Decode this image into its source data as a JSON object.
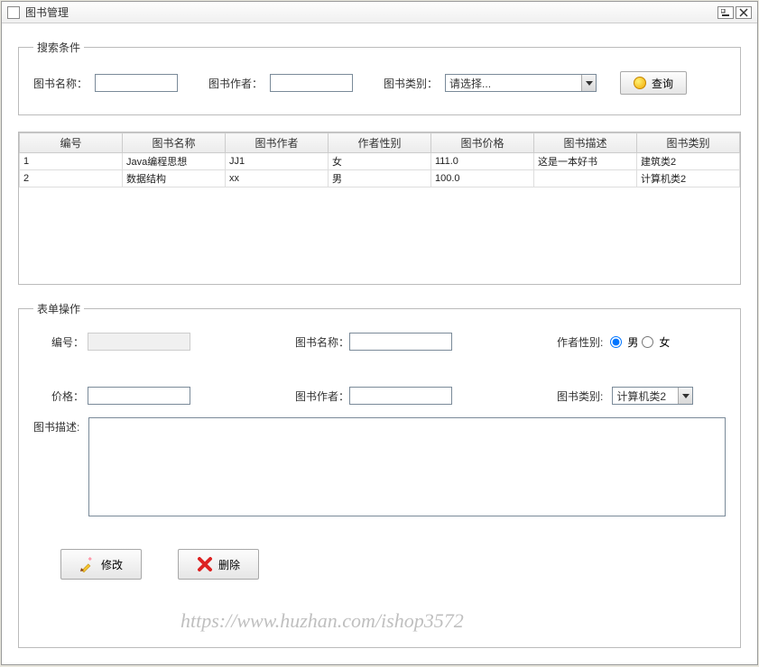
{
  "window": {
    "title": "图书管理"
  },
  "search": {
    "legend": "搜索条件",
    "name_label": "图书名称：",
    "author_label": "图书作者：",
    "category_label": "图书类别：",
    "category_placeholder": "请选择...",
    "query_label": "查询"
  },
  "table": {
    "headers": [
      "编号",
      "图书名称",
      "图书作者",
      "作者性别",
      "图书价格",
      "图书描述",
      "图书类别"
    ],
    "rows": [
      {
        "id": "1",
        "name": "Java编程思想",
        "author": "JJ1",
        "gender": "女",
        "price": "111.0",
        "desc": "这是一本好书",
        "category": "建筑类2"
      },
      {
        "id": "2",
        "name": "数据结构",
        "author": "xx",
        "gender": "男",
        "price": "100.0",
        "desc": "",
        "category": "计算机类2"
      }
    ]
  },
  "form": {
    "legend": "表单操作",
    "id_label": "编号：",
    "name_label": "图书名称：",
    "gender_label": "作者性别:",
    "gender_male": "男",
    "gender_female": "女",
    "price_label": "价格：",
    "author_label": "图书作者：",
    "category_label": "图书类别:",
    "category_value": "计算机类2",
    "desc_label": "图书描述:",
    "modify_label": "修改",
    "delete_label": "删除"
  },
  "watermark": "https://www.huzhan.com/ishop3572"
}
